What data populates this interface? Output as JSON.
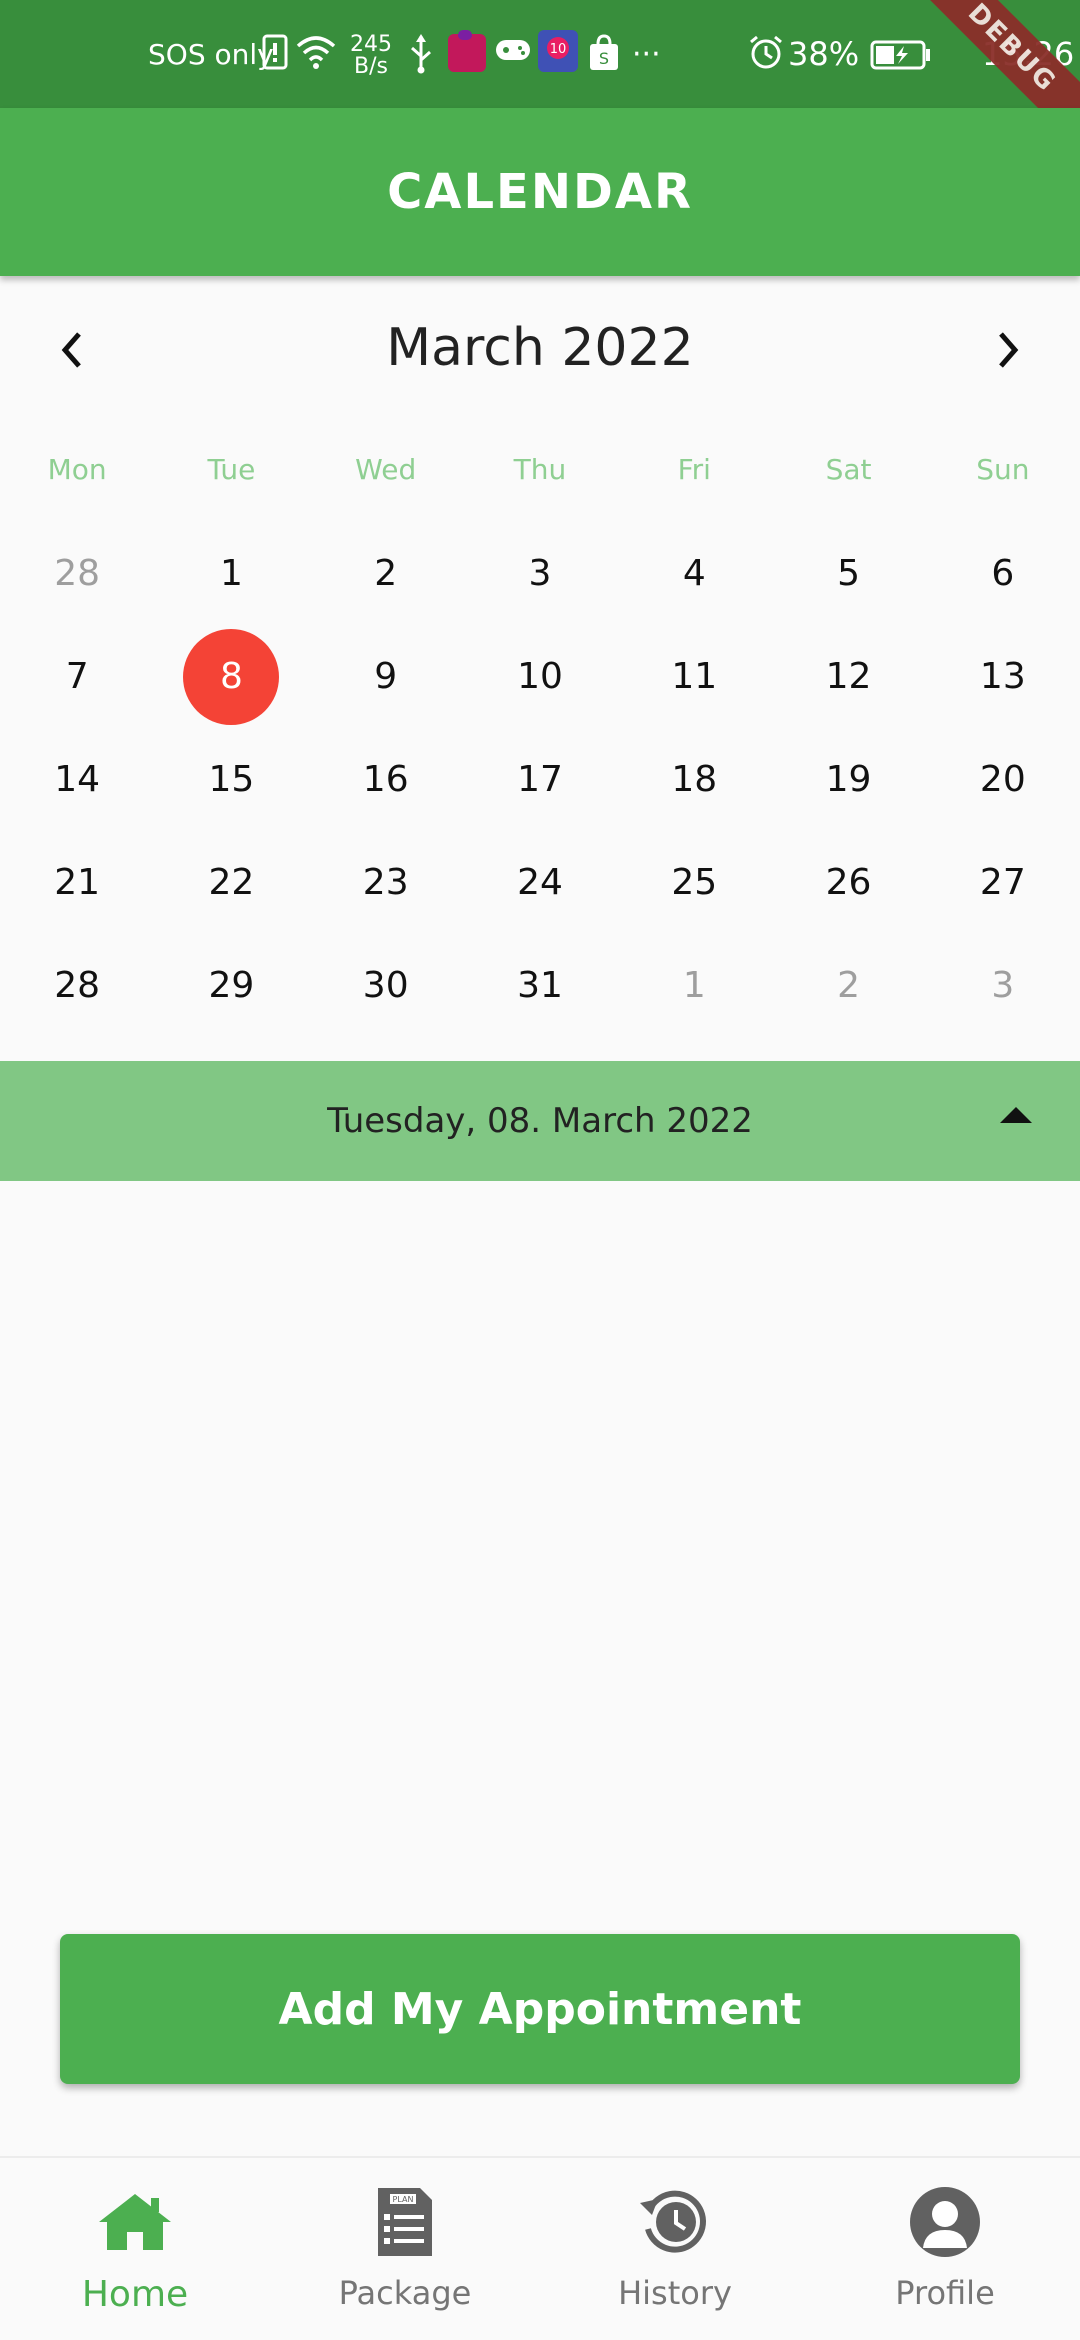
{
  "status_bar": {
    "carrier": "SOS only",
    "net_speed_value": "245",
    "net_speed_unit": "B/s",
    "more": "···",
    "battery_percent": "38%",
    "time": "15:26",
    "debug_banner": "DEBUG"
  },
  "app_bar": {
    "title": "CALENDAR"
  },
  "calendar": {
    "month_title": "March 2022",
    "weekdays": [
      "Mon",
      "Tue",
      "Wed",
      "Thu",
      "Fri",
      "Sat",
      "Sun"
    ],
    "weeks": [
      [
        "28",
        "1",
        "2",
        "3",
        "4",
        "5",
        "6"
      ],
      [
        "7",
        "8",
        "9",
        "10",
        "11",
        "12",
        "13"
      ],
      [
        "14",
        "15",
        "16",
        "17",
        "18",
        "19",
        "20"
      ],
      [
        "21",
        "22",
        "23",
        "24",
        "25",
        "26",
        "27"
      ],
      [
        "28",
        "29",
        "30",
        "31",
        "1",
        "2",
        "3"
      ]
    ],
    "selected_day": "8"
  },
  "selected_date_bar": {
    "text": "Tuesday, 08. March 2022"
  },
  "add_button": {
    "label": "Add My Appointment"
  },
  "bottom_nav": {
    "items": [
      {
        "label": "Home",
        "icon": "home-icon",
        "active": true
      },
      {
        "label": "Package",
        "icon": "plan-document-icon",
        "active": false
      },
      {
        "label": "History",
        "icon": "history-icon",
        "active": false
      },
      {
        "label": "Profile",
        "icon": "profile-icon",
        "active": false
      }
    ]
  },
  "colors": {
    "primary": "#4caf50",
    "status_bar": "#388e3c",
    "selected_day": "#f44336",
    "date_bar": "#81c784",
    "weekday_text": "#8fcf92"
  }
}
